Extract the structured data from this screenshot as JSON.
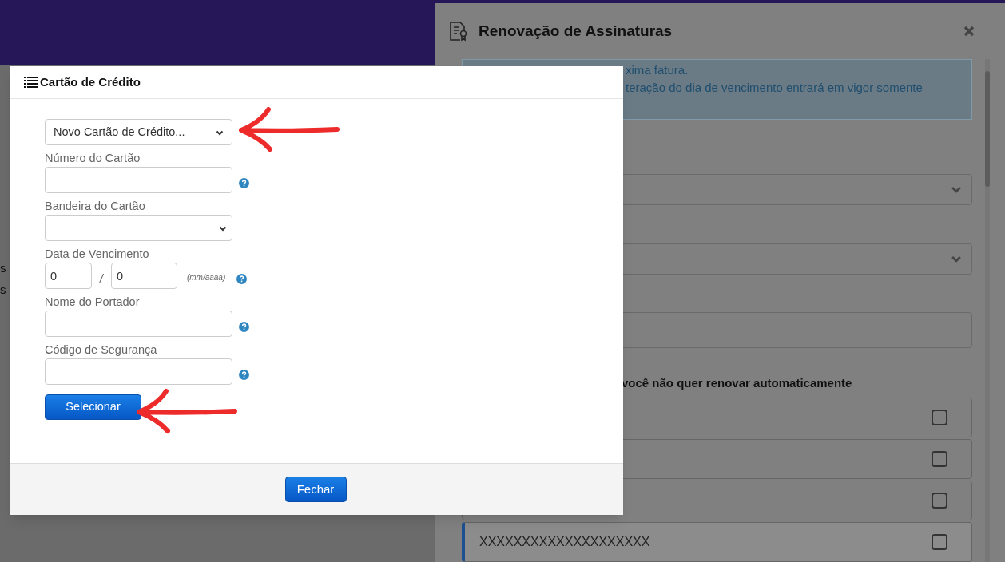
{
  "background_page": {
    "cut_texts": [
      "s",
      "s"
    ]
  },
  "side_panel": {
    "title": "Renovação de Assinaturas",
    "info_lines": [
      "xima fatura.",
      "teração do dia de vencimento entrará em vigor somente"
    ],
    "selects": [
      {
        "kind": "select"
      },
      {
        "kind": "select"
      },
      {
        "kind": "input"
      }
    ],
    "list_heading": "você não quer renovar automaticamente",
    "rows": [
      {
        "label": "",
        "checked": false,
        "selected": false
      },
      {
        "label": "",
        "checked": false,
        "selected": false
      },
      {
        "label": "",
        "checked": false,
        "selected": false
      },
      {
        "label": "XXXXXXXXXXXXXXXXXXXX",
        "checked": false,
        "selected": true
      }
    ]
  },
  "modal": {
    "title": "Cartão de Crédito",
    "card_select": "Novo Cartão de Crédito...",
    "fields": [
      {
        "label": "Número do Cartão",
        "kind": "text",
        "help": true
      },
      {
        "label": "Bandeira do Cartão",
        "kind": "select",
        "help": false
      },
      {
        "label": "Data de Vencimento",
        "kind": "date",
        "month": "0",
        "year": "0",
        "separator": "/",
        "hint": "(mm/aaaa)",
        "help": true
      },
      {
        "label": "Nome do Portador",
        "kind": "text",
        "help": true
      },
      {
        "label": "Código de Segurança",
        "kind": "text",
        "help": true
      }
    ],
    "select_button": "Selecionar",
    "close_button": "Fechar"
  }
}
